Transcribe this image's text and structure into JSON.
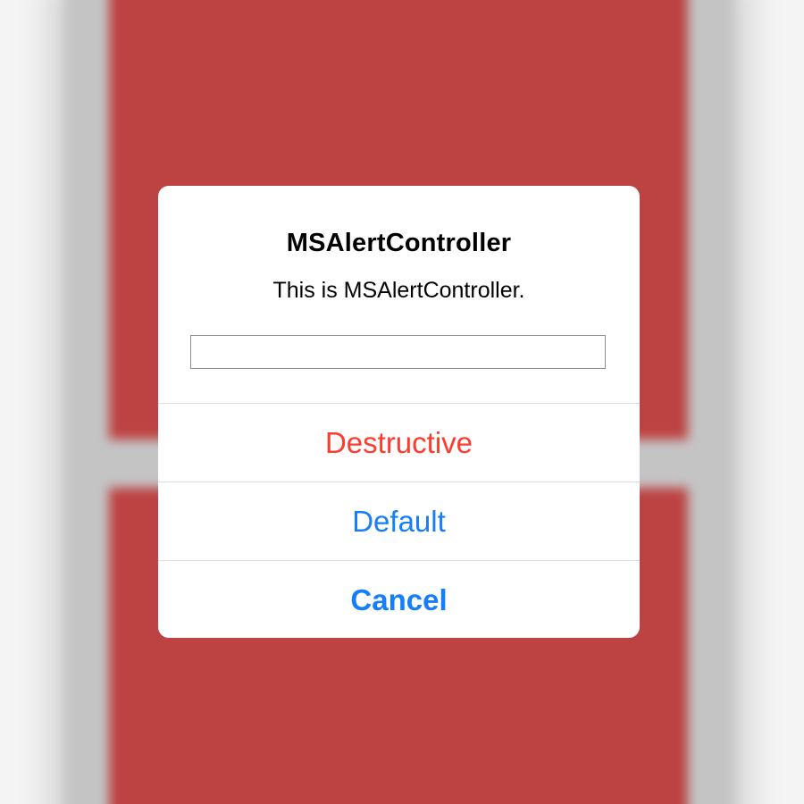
{
  "alert": {
    "title": "MSAlertController",
    "message": "This is MSAlertController.",
    "text_field": {
      "value": "",
      "placeholder": ""
    },
    "actions": [
      {
        "label": "Destructive",
        "style": "destructive",
        "color": "#ff3b30"
      },
      {
        "label": "Default",
        "style": "default",
        "color": "#157efb"
      },
      {
        "label": "Cancel",
        "style": "cancel",
        "color": "#157efb"
      }
    ]
  },
  "colors": {
    "background_block": "#bd4242",
    "background_frame": "#c4c4c4",
    "dialog": "#ffffff"
  }
}
